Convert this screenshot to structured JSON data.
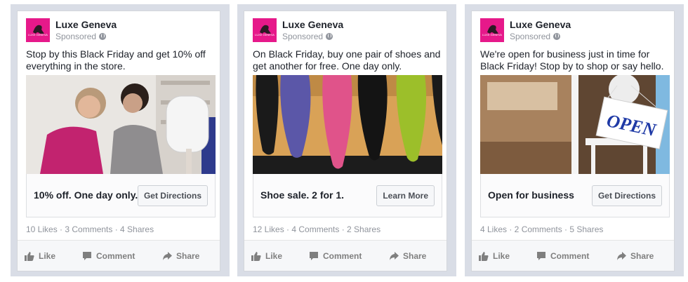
{
  "colors": {
    "brand_logo": "#e6198a",
    "panel_bg": "#d9dde6",
    "text_primary": "#1d2129",
    "text_secondary": "#90949c"
  },
  "ads": [
    {
      "page_name": "Luxe Geneva",
      "logo_text": "LUXE GENEVA",
      "sponsored": "Sponsored",
      "message": "Stop by this Black Friday and get 10% off everything in the store.",
      "headline": "10% off. One day only.",
      "cta": "Get Directions",
      "stats": "10 Likes · 3 Comments · 4 Shares",
      "actions": {
        "like": "Like",
        "comment": "Comment",
        "share": "Share"
      },
      "image": "two-women-shopping-mirror"
    },
    {
      "page_name": "Luxe Geneva",
      "logo_text": "LUXE GENEVA",
      "sponsored": "Sponsored",
      "message": "On Black Friday, buy one pair of shoes and get another for free. One day only.",
      "headline": "Shoe sale. 2 for 1.",
      "cta": "Learn More",
      "stats": "12 Likes · 4 Comments · 2 Shares",
      "actions": {
        "like": "Like",
        "comment": "Comment",
        "share": "Share"
      },
      "image": "colorful-high-heels"
    },
    {
      "page_name": "Luxe Geneva",
      "logo_text": "LUXE GENEVA",
      "sponsored": "Sponsored",
      "message": "We're open for business just in time for Black Friday! Stop by to shop or say hello.",
      "headline": "Open for business",
      "cta": "Get Directions",
      "stats": "4 Likes · 2 Comments · 5 Shares",
      "actions": {
        "like": "Like",
        "comment": "Comment",
        "share": "Share"
      },
      "image": "open-sign-on-chair",
      "sign_text": "OPEN"
    }
  ]
}
